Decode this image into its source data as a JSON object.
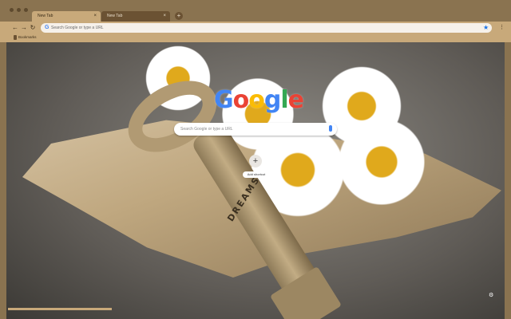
{
  "tabs": [
    {
      "label": "New Tab",
      "close": "×",
      "active": true
    },
    {
      "label": "New Tab",
      "close": "×",
      "active": false
    }
  ],
  "new_tab_glyph": "+",
  "toolbar": {
    "back_glyph": "←",
    "forward_glyph": "→",
    "reload_glyph": "↻",
    "omnibox_icon": "G",
    "omnibox_placeholder": "Search Google or type a URL",
    "star_glyph": "★",
    "menu_glyph": "⋮"
  },
  "bookmarks_bar": {
    "label": "Bookmarks"
  },
  "ntp": {
    "logo_letters": [
      "G",
      "o",
      "o",
      "g",
      "l",
      "e"
    ],
    "logo_colors": [
      "#4285f4",
      "#ea4335",
      "#fbbc05",
      "#4285f4",
      "#34a853",
      "#ea4335"
    ],
    "search_placeholder": "Search Google or type a URL",
    "shortcut_glyph": "+",
    "shortcut_label": "Add shortcut",
    "customize_glyph": "⚙"
  },
  "background": {
    "key_engraving": "DREAMS"
  },
  "icons": [
    "back-icon",
    "forward-icon",
    "reload-icon",
    "star-icon",
    "menu-icon",
    "mic-icon",
    "gear-icon",
    "bookmark-folder-icon"
  ],
  "colors": {
    "frame": "#8a7350",
    "toolbar": "#c8a97a",
    "inactive_tab": "#6b5233"
  }
}
